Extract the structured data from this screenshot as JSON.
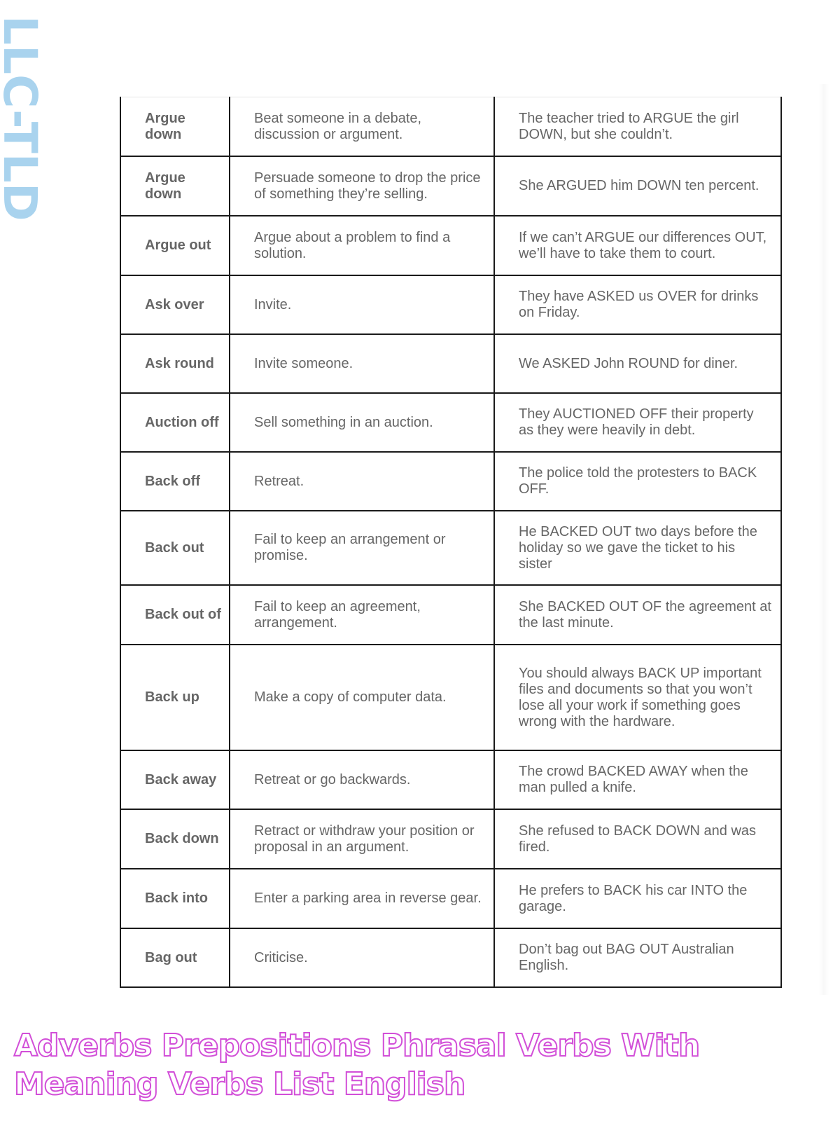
{
  "watermark": "LLC-TLD",
  "table": {
    "rows": [
      {
        "verb": "Argue down",
        "meaning": "Beat someone in a debate, discussion or argument.",
        "example": "The teacher tried to ARGUE the girl DOWN, but she couldn’t."
      },
      {
        "verb": "Argue down",
        "meaning": "Persuade someone to drop the price of something they’re selling.",
        "example": "She ARGUED him DOWN ten percent."
      },
      {
        "verb": "Argue out",
        "meaning": "Argue about a problem to find a solution.",
        "example": "If we can’t ARGUE our differences OUT, we’ll have to take them to court."
      },
      {
        "verb": "Ask over",
        "meaning": "Invite.",
        "example": "They have ASKED us OVER for drinks on Friday."
      },
      {
        "verb": "Ask round",
        "meaning": "Invite someone.",
        "example": "We ASKED John ROUND for diner."
      },
      {
        "verb": "Auction off",
        "meaning": "Sell something in an auction.",
        "example": "They AUCTIONED OFF their property as they were heavily in debt."
      },
      {
        "verb": "Back off",
        "meaning": "Retreat.",
        "example": "The police told the protesters to BACK OFF."
      },
      {
        "verb": "Back out",
        "meaning": "Fail to keep an arrangement or promise.",
        "example": "He BACKED OUT two days before the holiday so we gave the ticket to his sister"
      },
      {
        "verb": "Back out of",
        "meaning": "Fail to keep an agreement, arrangement.",
        "example": "She BACKED OUT OF the agreement at the last minute."
      },
      {
        "verb": "Back up",
        "meaning": "Make a copy of computer data.",
        "example": "You should always BACK UP important files and documents so that you won’t lose all your work if something goes wrong with the hardware."
      },
      {
        "verb": "Back away",
        "meaning": "Retreat or go backwards.",
        "example": "The crowd BACKED AWAY when the man pulled a knife."
      },
      {
        "verb": "Back down",
        "meaning": "Retract or withdraw your position or proposal in an argument.",
        "example": "She refused to BACK DOWN and was fired."
      },
      {
        "verb": "Back into",
        "meaning": "Enter a parking area in reverse gear.",
        "example": "He prefers to BACK his car INTO the garage."
      },
      {
        "verb": "Bag out",
        "meaning": "Criticise.",
        "example": "Don’t bag out BAG OUT Australian English."
      }
    ]
  },
  "caption": "Adverbs Prepositions Phrasal Verbs With Meaning Verbs List English",
  "colors": {
    "watermark": "#a9d3ee",
    "caption_outline": "#d24fd8",
    "table_text": "#666666",
    "table_border": "#1a1a1a"
  }
}
